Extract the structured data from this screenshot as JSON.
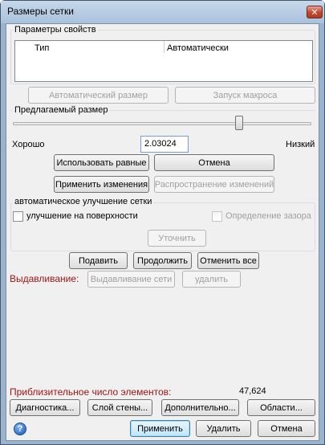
{
  "window": {
    "title": "Размеры сетки",
    "close_glyph": "✕"
  },
  "properties": {
    "group_label": "Параметры свойств",
    "columns": [
      "Тип",
      "Автоматически"
    ]
  },
  "top_buttons": {
    "auto_size": "Автоматический размер",
    "run_macro": "Запуск макроса"
  },
  "size": {
    "group_label": "Предлагаемый размер",
    "slider_level": 0.93,
    "good_label": "Хорошо",
    "low_label": "Низкий",
    "value": "2.03024",
    "use_equal": "Использовать равные",
    "cancel": "Отмена",
    "apply_changes": "Применить изменения",
    "propagate_changes": "Распространение изменений"
  },
  "refine": {
    "group_label": "автоматическое улучшение сетки",
    "surface_label": "улучшение на поверхности",
    "gap_label": "Определение зазора",
    "refine_button": "Уточнить"
  },
  "actions": {
    "suppress": "Подавить",
    "continue": "Продолжить",
    "undo_all": "Отменить все"
  },
  "extrude": {
    "label": "Выдавливание:",
    "extrude_button": "Выдавливание сети",
    "delete_button": "удалить"
  },
  "stats": {
    "label": "Приблизительное число элементов:",
    "value": "47,624"
  },
  "bottom_row1": {
    "diagnostics": "Диагностика...",
    "wall_layer": "Слой стены...",
    "advanced": "Дополнительно...",
    "regions": "Области..."
  },
  "bottom_row2": {
    "help_glyph": "?",
    "apply": "Применить",
    "delete": "Удалить",
    "cancel": "Отмена"
  }
}
